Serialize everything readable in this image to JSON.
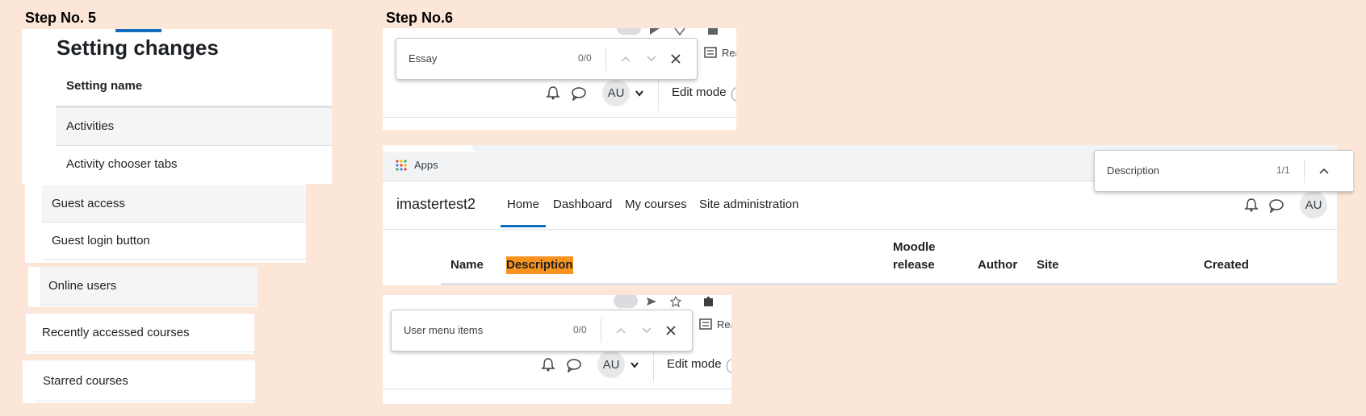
{
  "step5": {
    "label": "Step No. 5",
    "heading": "Setting changes",
    "column_header": "Setting name",
    "rows": [
      "Activities",
      "Activity chooser tabs",
      "Guest access",
      "Guest login button",
      "Online users",
      "Recently accessed courses",
      "Starred courses"
    ]
  },
  "step6": {
    "label": "Step No.6",
    "top": {
      "find_query": "Essay",
      "find_count": "0/0",
      "reading_list": "Rea",
      "avatar": "AU",
      "edit_mode": "Edit mode"
    },
    "middle": {
      "bookmark_apps": "Apps",
      "find_query": "Description",
      "find_count": "1/1",
      "site_name": "imastertest2",
      "nav": [
        "Home",
        "Dashboard",
        "My courses",
        "Site administration"
      ],
      "avatar": "AU",
      "table_headers": {
        "name": "Name",
        "description": "Description",
        "moodle_release_1": "Moodle",
        "moodle_release_2": "release",
        "author": "Author",
        "site": "Site",
        "created": "Created"
      },
      "highlight_color": "#f7931e",
      "active_tab_color": "#0f6cbf"
    },
    "bottom": {
      "find_query": "User menu items",
      "find_count": "0/0",
      "reading_list": "Rea",
      "avatar": "AU",
      "edit_mode": "Edit mode"
    }
  }
}
